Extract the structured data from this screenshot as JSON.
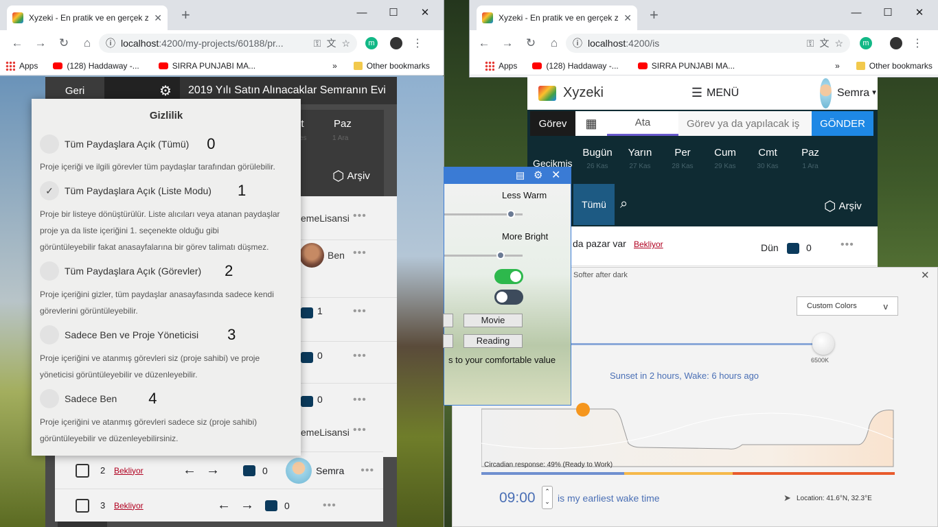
{
  "left_browser": {
    "tab_title": "Xyzeki - En pratik ve en gerçek za",
    "url_host": "localhost",
    "url_path": ":4200/my-projects/60188/pr...",
    "ext_letter": "m",
    "bookmarks": [
      "Apps",
      "(128) Haddaway -...",
      "SIRRA PUNJABI MA..."
    ],
    "other_bookmarks": "Other bookmarks",
    "overflow": "»"
  },
  "right_browser": {
    "tab_title": "Xyzeki - En pratik ve en gerçek za",
    "url_host": "localhost",
    "url_path": ":4200/is",
    "ext_letter": "m",
    "bookmarks": [
      "Apps",
      "(128) Haddaway -...",
      "SIRRA PUNJABI MA..."
    ],
    "other_bookmarks": "Other bookmarks",
    "overflow": "»"
  },
  "left_app": {
    "back": "Geri",
    "project_title": "2019 Yılı Satın Alınacaklar Semranın Evi",
    "days": [
      {
        "label": "nt",
        "date": "es"
      },
      {
        "label": "Paz",
        "date": "1 Ara"
      }
    ],
    "archive": "Arşiv",
    "rows": [
      {
        "right_text": "emeLisansi"
      },
      {
        "right_text": "Ben"
      },
      {
        "count": "1"
      },
      {
        "count": "0"
      },
      {
        "count": "0"
      },
      {
        "right_text": "emeLisansi"
      }
    ],
    "bottom_rows": [
      {
        "num": "2",
        "status": "Bekliyor",
        "count": "0",
        "user": "Semra"
      },
      {
        "num": "3",
        "status": "Bekliyor",
        "count": "0"
      }
    ]
  },
  "privacy_modal": {
    "title": "Gizlilik",
    "options": [
      {
        "label": "Tüm Paydaşlara Açık (Tümü)",
        "num": "0",
        "desc": [
          "Proje içeriği ve ilgili görevler tüm paydaşlar tarafından görülebilir."
        ],
        "checked": false
      },
      {
        "label": "Tüm Paydaşlara Açık (Liste Modu)",
        "num": "1",
        "desc": [
          "Proje bir listeye dönüştürülür. Liste alıcıları veya atanan paydaşlar",
          "proje ya da liste içeriğini 1. seçenekte olduğu gibi",
          "görüntüleyebilir fakat anasayfalarına bir görev talimatı düşmez."
        ],
        "checked": true
      },
      {
        "label": "Tüm Paydaşlara Açık (Görevler)",
        "num": "2",
        "desc": [
          "Proje içeriğini gizler, tüm paydaşlar anasayfasında sadece kendi",
          "görevlerini görüntüleyebilir."
        ],
        "checked": false
      },
      {
        "label": "Sadece Ben ve Proje Yöneticisi",
        "num": "3",
        "desc": [
          "Proje içeriğini ve atanmış görevleri siz (proje sahibi) ve proje",
          "yöneticisi görüntüleyebilir ve düzenleyebilir."
        ],
        "checked": false
      },
      {
        "label": "Sadece Ben",
        "num": "4",
        "desc": [
          "Proje içeriğini ve atanmış görevleri sadece siz (proje sahibi)",
          "görüntüleyebilir ve düzenleyebilirsiniz."
        ],
        "checked": false
      }
    ]
  },
  "right_app": {
    "brand": "Xyzeki",
    "menu": "MENÜ",
    "user": "Semra",
    "task_tab": "Görev",
    "assign_tab": "Ata",
    "task_placeholder": "Görev ya da yapılacak iş",
    "send": "GÖNDER",
    "overdue": "Gecikmiş",
    "days": [
      {
        "label": "Bugün",
        "date": "26 Kas"
      },
      {
        "label": "Yarın",
        "date": "27 Kas"
      },
      {
        "label": "Per",
        "date": "28 Kas"
      },
      {
        "label": "Cum",
        "date": "29 Kas"
      },
      {
        "label": "Cmt",
        "date": "30 Kas"
      },
      {
        "label": "Paz",
        "date": "1 Ara"
      }
    ],
    "all": "Tümü",
    "archive": "Arşiv",
    "task_text": "da pazar var",
    "task_status": "Bekliyor",
    "task_due": "Dün",
    "task_count": "0"
  },
  "flux_small": {
    "less_warm": "Less Warm",
    "more_bright": "More Bright",
    "warm_level": 0.85,
    "bright_level": 0.72,
    "toggle1_on": true,
    "toggle2_on": false,
    "movie": "Movie",
    "reading": "Reading",
    "hint": "s to your comfortable value",
    "colors": {
      "toggle_on": "#2db84c",
      "toggle_off": "#3d4b5c",
      "accent": "#3a7bd5"
    }
  },
  "flux_big": {
    "title": "Softer after dark",
    "preset": "Custom Colors",
    "temp_label": "6500K",
    "sunset": "Sunset in 2 hours, Wake: 6 hours ago",
    "circadian": "Circadian response: 49% (Ready to Work)",
    "wake_time": "09:00",
    "wake_label": "is my earliest wake time",
    "location": "Location: 41.6°N, 32.3°E",
    "colors": {
      "sun": "#f5961d",
      "link": "#4a6fb5"
    }
  }
}
